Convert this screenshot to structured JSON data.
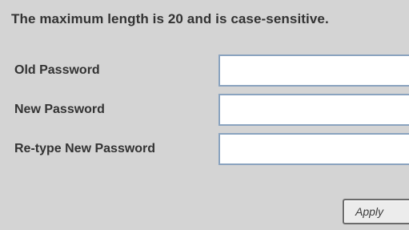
{
  "form": {
    "notice": "The maximum length is 20 and is case-sensitive.",
    "fields": [
      {
        "label": "Old Password",
        "value": ""
      },
      {
        "label": "New Password",
        "value": ""
      },
      {
        "label": "Re-type New Password",
        "value": ""
      }
    ],
    "apply_label": "Apply"
  }
}
